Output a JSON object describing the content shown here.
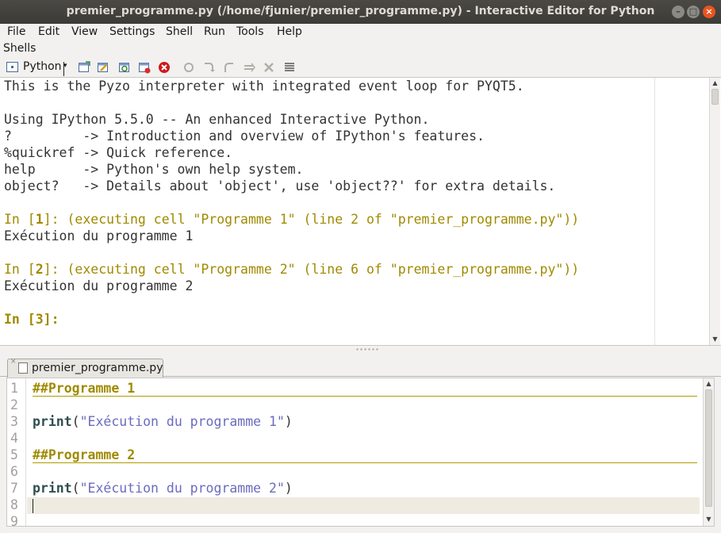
{
  "window": {
    "title": "premier_programme.py (/home/fjunier/premier_programme.py) - Interactive Editor for Python"
  },
  "menu": [
    "File",
    "Edit",
    "View",
    "Settings",
    "Shell",
    "Run",
    "Tools",
    "Help"
  ],
  "shells_label": "Shells",
  "shell_toolbar": {
    "shell_name": "Python",
    "caret": "▾"
  },
  "shell": {
    "lines": [
      "This is the Pyzo interpreter with integrated event loop for PYQT5.",
      "",
      "Using IPython 5.5.0 -- An enhanced Interactive Python.",
      "?         -> Introduction and overview of IPython's features.",
      "%quickref -> Quick reference.",
      "help      -> Python's own help system.",
      "object?   -> Details about 'object', use 'object??' for extra details."
    ],
    "cells": [
      {
        "prompt_pre": "In [",
        "num": "1",
        "prompt_post": "]: (executing cell \"Programme 1\" (line 2 of \"premier_programme.py\"))",
        "output": "Exécution du programme 1"
      },
      {
        "prompt_pre": "In [",
        "num": "2",
        "prompt_post": "]: (executing cell \"Programme 2\" (line 6 of \"premier_programme.py\"))",
        "output": "Exécution du programme 2"
      }
    ],
    "current_prompt": "In [3]:"
  },
  "editor": {
    "tab_name": "premier_programme.py",
    "tab_close": "×",
    "line_numbers": [
      "1",
      "2",
      "3",
      "4",
      "5",
      "6",
      "7",
      "8",
      "9"
    ],
    "cell1": "##Programme 1",
    "cell2": "##Programme 2",
    "print_kw": "print",
    "open_paren": "(",
    "close_paren": ")",
    "str1": "\"Exécution du programme 1\"",
    "str2": "\"Exécution du programme 2\""
  },
  "colors": {
    "titlebar": "#3c3b37",
    "close_button": "#e95420",
    "prompt": "#a08a00",
    "string": "#6b6bbf",
    "current_line": "#f0ebe1"
  }
}
